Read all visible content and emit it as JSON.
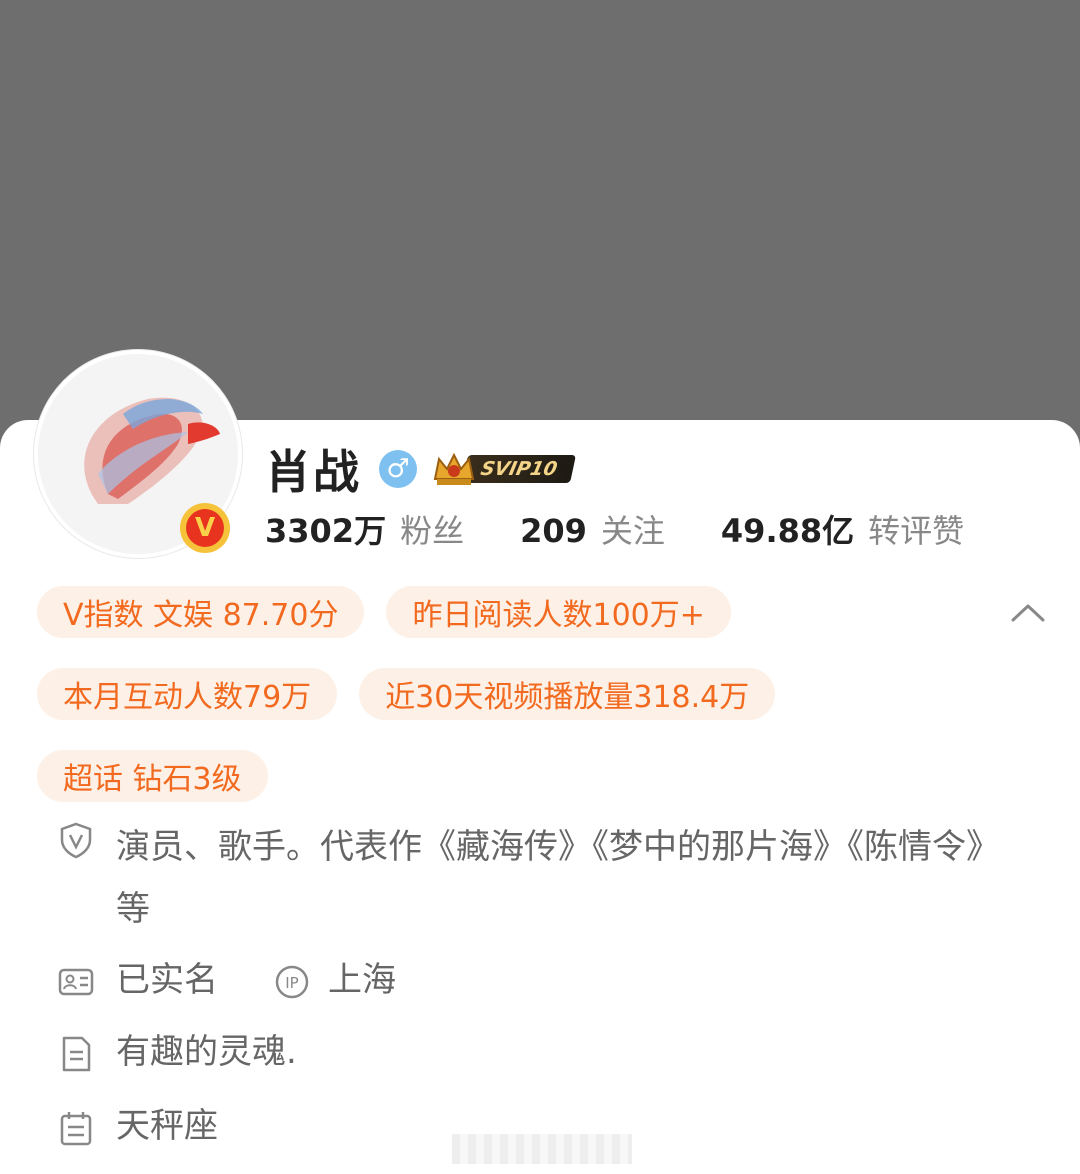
{
  "profile": {
    "name": "肖战",
    "gender_icon": "male-gender-icon",
    "vip_badge": "SVIP10",
    "verified_badge": "V"
  },
  "stats": [
    {
      "value": "3302万",
      "label": "粉丝"
    },
    {
      "value": "209",
      "label": "关注"
    },
    {
      "value": "49.88亿",
      "label": "转评赞"
    }
  ],
  "chips": {
    "row1": [
      "V指数 文娱 87.70分",
      "昨日阅读人数100万+"
    ],
    "row2": [
      "本月互动人数79万",
      "近30天视频播放量318.4万"
    ],
    "row3": [
      "超话 钻石3级"
    ]
  },
  "info": {
    "description": "演员、歌手。代表作《藏海传》《梦中的那片海》《陈情令》等",
    "real_name": "已实名",
    "ip": "上海",
    "bio": "有趣的灵魂.",
    "zodiac": "天秤座"
  },
  "colors": {
    "cover": "#6e6e6e",
    "chip_bg": "#fdf0e6",
    "chip_text": "#f26a1f",
    "gender": "#7ec1f0"
  }
}
